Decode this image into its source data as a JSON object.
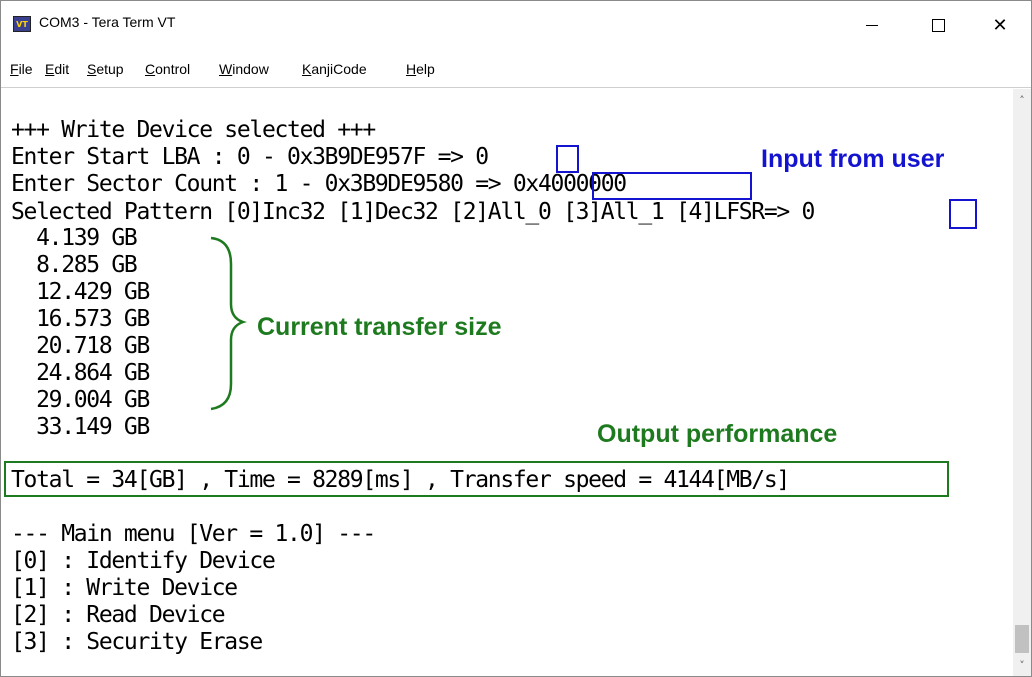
{
  "window": {
    "icon_label": "VT",
    "title": "COM3 - Tera Term VT",
    "minimize_glyph": "—",
    "maximize_glyph": "☐",
    "close_glyph": "✕"
  },
  "menu": [
    {
      "label": "File",
      "u": "F",
      "rest": "ile"
    },
    {
      "label": "Edit",
      "u": "E",
      "rest": "dit"
    },
    {
      "label": "Setup",
      "u": "S",
      "rest": "etup"
    },
    {
      "label": "Control",
      "u": "C",
      "rest": "ontrol"
    },
    {
      "label": "Window",
      "u": "W",
      "rest": "indow"
    },
    {
      "label": "KanjiCode",
      "u": "K",
      "rest": "anjiCode"
    },
    {
      "label": "Help",
      "u": "H",
      "rest": "elp"
    }
  ],
  "terminal": {
    "lines": [
      "+++ Write Device selected +++",
      "Enter Start LBA : 0 - 0x3B9DE957F => 0",
      "Enter Sector Count : 1 - 0x3B9DE9580 => 0x4000000",
      "Selected Pattern [0]Inc32 [1]Dec32 [2]All_0 [3]All_1 [4]LFSR=> 0",
      "  4.139 GB",
      "  8.285 GB",
      "  12.429 GB",
      "  16.573 GB",
      "  20.718 GB",
      "  24.864 GB",
      "  29.004 GB",
      "  33.149 GB",
      "",
      "Total = 34[GB] , Time = 8289[ms] , Transfer speed = 4144[MB/s]",
      "",
      "--- Main menu [Ver = 1.0] ---",
      "[0] : Identify Device",
      "[1] : Write Device",
      "[2] : Read Device",
      "[3] : Security Erase"
    ]
  },
  "annotations": {
    "input_from_user": "Input from user",
    "current_transfer_size": "Current transfer size",
    "output_performance": "Output performance"
  },
  "colors": {
    "annotation_blue": "#1414d0",
    "annotation_green": "#1e7a1e"
  },
  "scrollbar": {
    "up_glyph": "˄",
    "down_glyph": "˅"
  }
}
